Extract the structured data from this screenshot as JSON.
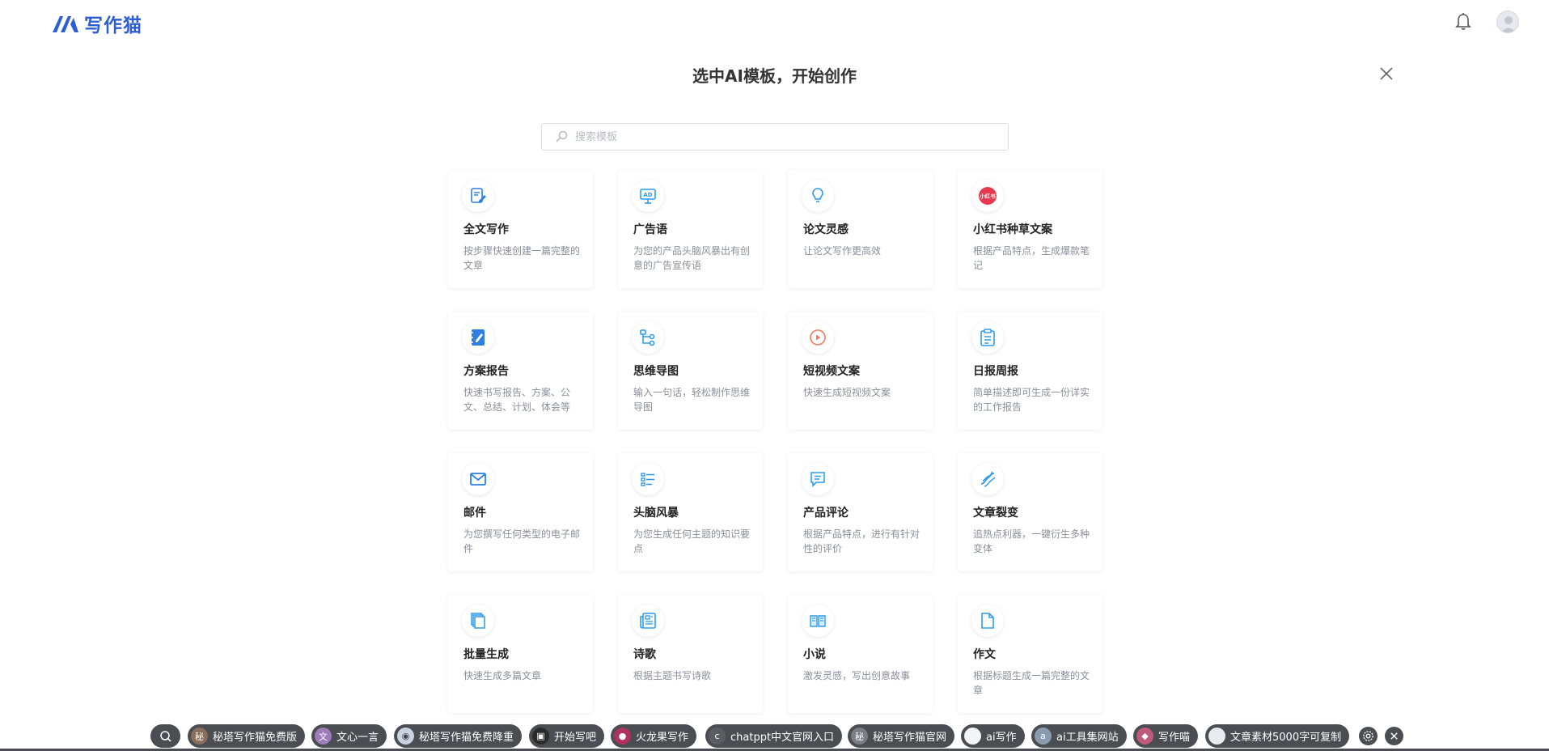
{
  "app": {
    "logo_text": "写作猫"
  },
  "modal": {
    "title": "选中AI模板，开始创作",
    "search_placeholder": "搜索模板"
  },
  "colors": {
    "brand": "#2c5fd4",
    "icon_blue": "#2f9ceb",
    "red_badge": "#e8384f"
  },
  "cards": [
    {
      "title": "全文写作",
      "desc": "按步骤快速创建一篇完整的文章",
      "icon": "edit-doc-icon"
    },
    {
      "title": "广告语",
      "desc": "为您的产品头脑风暴出有创意的广告宣传语",
      "icon": "ad-board-icon"
    },
    {
      "title": "论文灵感",
      "desc": "让论文写作更高效",
      "icon": "lightbulb-icon"
    },
    {
      "title": "小红书种草文案",
      "desc": "根据产品特点，生成爆款笔记",
      "icon": "xiaohongshu-icon",
      "badge": "小红书"
    },
    {
      "title": "方案报告",
      "desc": "快速书写报告、方案、公文、总结、计划、体会等",
      "icon": "notebook-pen-icon"
    },
    {
      "title": "思维导图",
      "desc": "输入一句话，轻松制作思维导图",
      "icon": "mindmap-icon"
    },
    {
      "title": "短视频文案",
      "desc": "快速生成短视频文案",
      "icon": "play-circle-icon"
    },
    {
      "title": "日报周报",
      "desc": "简单描述即可生成一份详实的工作报告",
      "icon": "clipboard-icon"
    },
    {
      "title": "邮件",
      "desc": "为您撰写任何类型的电子邮件",
      "icon": "mail-icon"
    },
    {
      "title": "头脑风暴",
      "desc": "为您生成任何主题的知识要点",
      "icon": "list-icon"
    },
    {
      "title": "产品评论",
      "desc": "根据产品特点，进行有针对性的评价",
      "icon": "comment-icon"
    },
    {
      "title": "文章裂变",
      "desc": "追热点利器，一键衍生多种变体",
      "icon": "split-icon"
    },
    {
      "title": "批量生成",
      "desc": "快速生成多篇文章",
      "icon": "stack-docs-icon"
    },
    {
      "title": "诗歌",
      "desc": "根据主题书写诗歌",
      "icon": "newspaper-icon"
    },
    {
      "title": "小说",
      "desc": "激发灵感，写出创意故事",
      "icon": "book-icon"
    },
    {
      "title": "作文",
      "desc": "根据标题生成一篇完整的文章",
      "icon": "file-icon"
    }
  ],
  "bottom_bar": {
    "pills": [
      {
        "label": "秘塔写作猫免费版",
        "pic": "秘",
        "color": "#8a6d5a"
      },
      {
        "label": "文心一言",
        "pic": "文",
        "color": "#9d7bb8"
      },
      {
        "label": "秘塔写作猫免费降重",
        "pic": "◉",
        "color": "#c9d4e0"
      },
      {
        "label": "开始写吧",
        "pic": "▣",
        "color": "#2b2b2b"
      },
      {
        "label": "火龙果写作",
        "pic": "●",
        "color": "#b03060"
      },
      {
        "label": "chatppt中文官网入口",
        "pic": "c",
        "color": "#5a5d62"
      },
      {
        "label": "秘塔写作猫官网",
        "pic": "秘",
        "color": "#7a7d82"
      },
      {
        "label": "ai写作",
        "pic": "",
        "color": "#f2f4f7"
      },
      {
        "label": "ai工具集网站",
        "pic": "a",
        "color": "#8a9bb0"
      },
      {
        "label": "写作喵",
        "pic": "◆",
        "color": "#c05a7a"
      },
      {
        "label": "文章素材5000字可复制",
        "pic": "",
        "color": "#e8eaee"
      }
    ]
  }
}
